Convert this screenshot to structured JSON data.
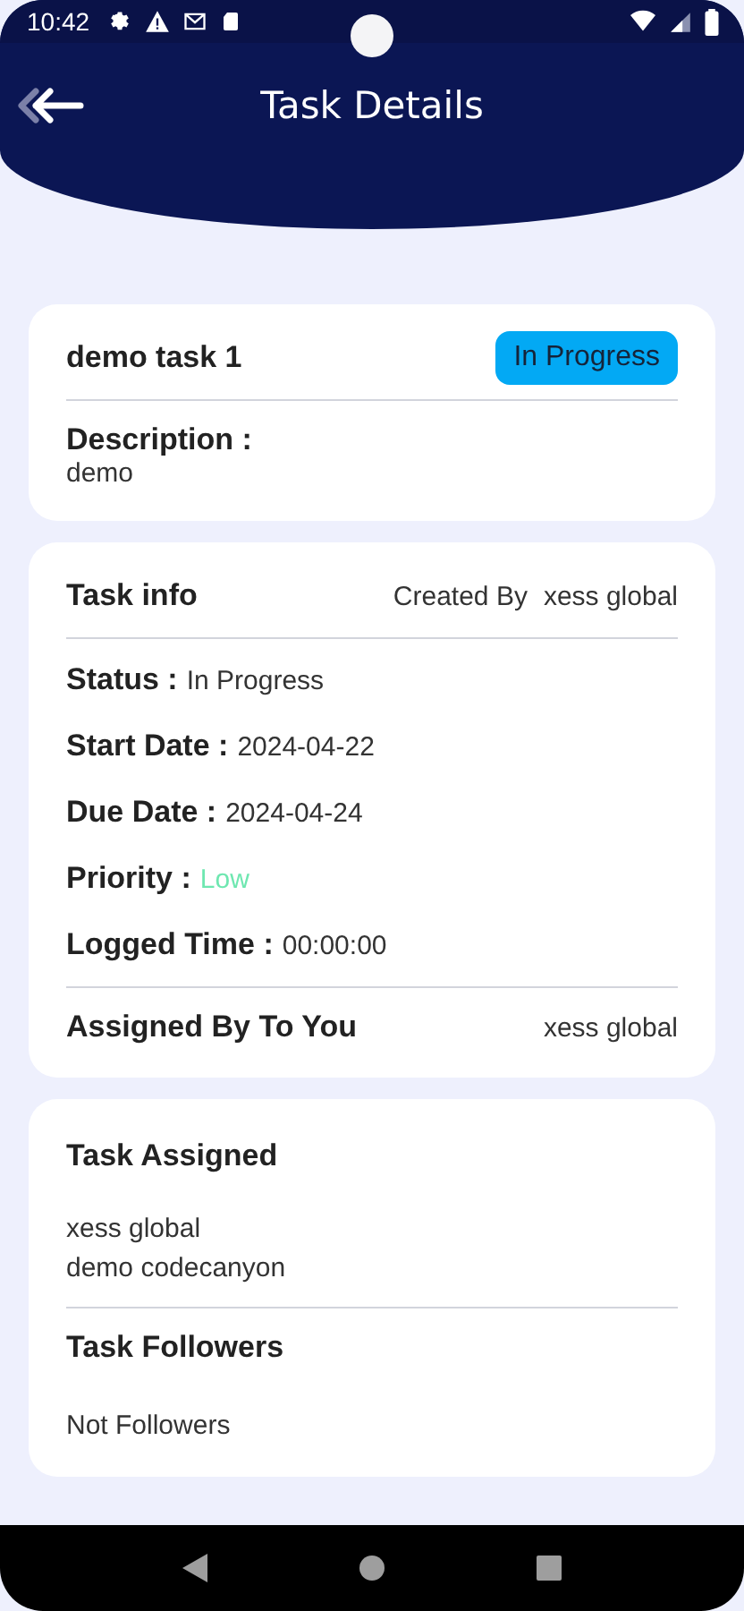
{
  "status_bar": {
    "time": "10:42"
  },
  "header": {
    "title": "Task Details"
  },
  "task": {
    "name": "demo task 1",
    "status_badge": {
      "text": "In Progress",
      "color": "#03a9f4"
    },
    "description_label": "Description :",
    "description": "demo"
  },
  "task_info": {
    "title": "Task info",
    "created_by_label": "Created By",
    "created_by": "xess global",
    "fields": [
      {
        "label": "Status :",
        "value": "In Progress"
      },
      {
        "label": "Start Date :",
        "value": "2024-04-22"
      },
      {
        "label": "Due Date :",
        "value": "2024-04-24"
      },
      {
        "label": "Priority :",
        "value": "Low",
        "color": "#6ee7b0"
      },
      {
        "label": "Logged Time :",
        "value": "00:00:00"
      }
    ],
    "assigned_by_label": "Assigned By To You",
    "assigned_by": "xess global"
  },
  "assigned": {
    "title": "Task Assigned",
    "people": [
      "xess global",
      "demo codecanyon"
    ]
  },
  "followers": {
    "title": "Task Followers",
    "empty_text": "Not Followers"
  }
}
